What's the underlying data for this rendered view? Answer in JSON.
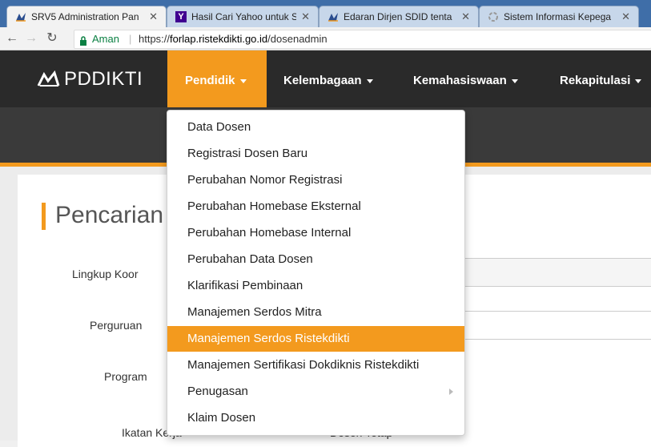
{
  "browser": {
    "tabs": [
      {
        "title": "SRV5 Administration Pan",
        "favicon": "ristekdikti-logo-icon"
      },
      {
        "title": "Hasil Cari Yahoo untuk S",
        "favicon": "yahoo-icon"
      },
      {
        "title": "Edaran Dirjen SDID tenta",
        "favicon": "ristekdikti-logo-icon"
      },
      {
        "title": "Sistem Informasi Kepega",
        "favicon": "loading-icon"
      }
    ],
    "security_label": "Aman",
    "url_prefix": "https://",
    "url_host": "forlap.ristekdikti.go.id",
    "url_path": "/dosenadmin"
  },
  "site": {
    "brand": "PDDIKTI",
    "nav": [
      "Pendidik",
      "Kelembagaan",
      "Kemahasiswaan",
      "Rekapitulasi"
    ],
    "accent_color": "#f39a1e"
  },
  "page": {
    "title": "Pencarian",
    "labels": [
      "Lingkup Koor",
      "Perguruan",
      "Program",
      "Ikatan Kerja"
    ],
    "ikatan_value": "Dosen Tetap"
  },
  "menu": {
    "items": [
      {
        "label": "Data Dosen"
      },
      {
        "label": "Registrasi Dosen Baru"
      },
      {
        "label": "Perubahan Nomor Registrasi"
      },
      {
        "label": "Perubahan Homebase Eksternal"
      },
      {
        "label": "Perubahan Homebase Internal"
      },
      {
        "label": "Perubahan Data Dosen"
      },
      {
        "label": "Klarifikasi Pembinaan"
      },
      {
        "label": "Manajemen Serdos Mitra"
      },
      {
        "label": "Manajemen Serdos Ristekdikti",
        "highlighted": true
      },
      {
        "label": "Manajemen Sertifikasi Dokdiknis Ristekdikti"
      },
      {
        "label": "Penugasan",
        "has_submenu": true
      },
      {
        "label": "Klaim Dosen"
      }
    ]
  }
}
